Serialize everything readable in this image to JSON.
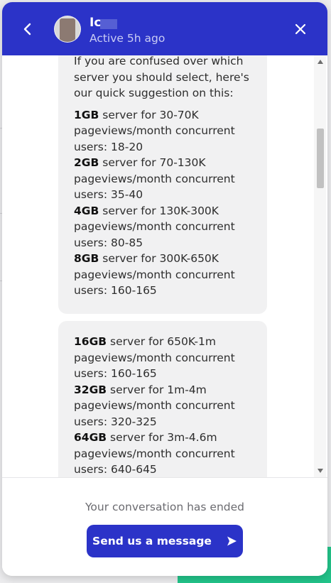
{
  "header": {
    "agent_name": "Ic",
    "status": "Active 5h ago",
    "back_icon": "chevron-left-icon",
    "close_icon": "close-icon",
    "background_color": "#2b33c8"
  },
  "messages": [
    {
      "intro": "If you are confused over which server you should select, here's our quick suggestion on this:",
      "lines": [
        {
          "size": "1GB",
          "text": " server for 30-70K pageviews/month concurrent users: 18-20"
        },
        {
          "size": "2GB",
          "text": " server for 70-130K pageviews/month concurrent users: 35-40"
        },
        {
          "size": "4GB",
          "text": " server for 130K-300K pageviews/month concurrent users: 80-85"
        },
        {
          "size": "8GB",
          "text": " server for 300K-650K pageviews/month concurrent users: 160-165"
        }
      ]
    },
    {
      "lines": [
        {
          "size": "16GB",
          "text": " server for 650K-1m pageviews/month concurrent users: 160-165"
        },
        {
          "size": "32GB",
          "text": " server for 1m-4m pageviews/month concurrent users: 320-325"
        },
        {
          "size": "64GB",
          "text": " server for 3m-4.6m pageviews/month concurrent users: 640-645"
        }
      ]
    }
  ],
  "footer": {
    "ended_text": "Your conversation has ended",
    "send_label": "Send us a message",
    "send_icon": "send-arrow-icon"
  }
}
